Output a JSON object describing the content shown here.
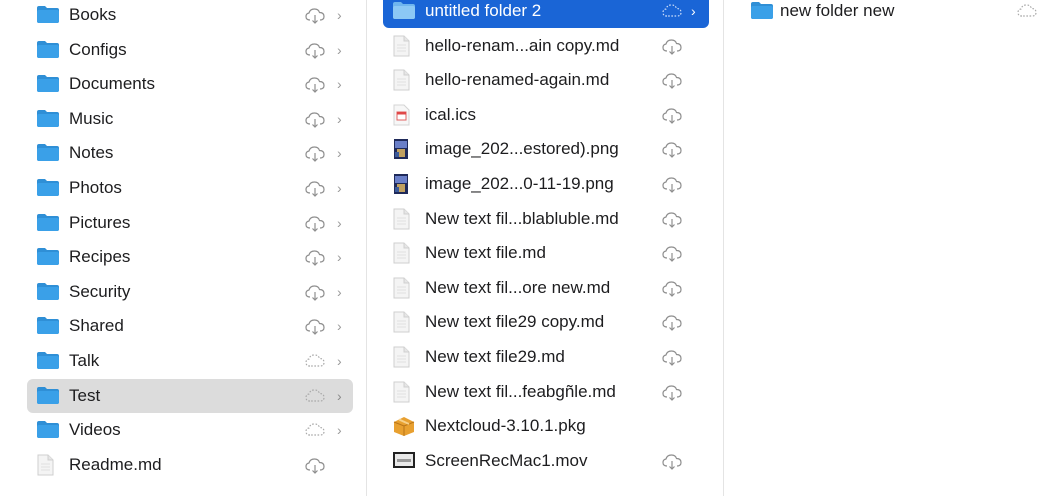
{
  "columns": {
    "first": {
      "items": [
        {
          "label": "Books",
          "type": "folder",
          "cloud": "download",
          "chevron": "›",
          "selected": "none"
        },
        {
          "label": "Configs",
          "type": "folder",
          "cloud": "download",
          "chevron": "›",
          "selected": "none"
        },
        {
          "label": "Documents",
          "type": "folder",
          "cloud": "download",
          "chevron": "›",
          "selected": "none"
        },
        {
          "label": "Music",
          "type": "folder",
          "cloud": "download",
          "chevron": "›",
          "selected": "none"
        },
        {
          "label": "Notes",
          "type": "folder",
          "cloud": "download",
          "chevron": "›",
          "selected": "none"
        },
        {
          "label": "Photos",
          "type": "folder",
          "cloud": "download",
          "chevron": "›",
          "selected": "none"
        },
        {
          "label": "Pictures",
          "type": "folder",
          "cloud": "download",
          "chevron": "›",
          "selected": "none"
        },
        {
          "label": "Recipes",
          "type": "folder",
          "cloud": "download",
          "chevron": "›",
          "selected": "none"
        },
        {
          "label": "Security",
          "type": "folder",
          "cloud": "download",
          "chevron": "›",
          "selected": "none"
        },
        {
          "label": "Shared",
          "type": "folder",
          "cloud": "download",
          "chevron": "›",
          "selected": "none"
        },
        {
          "label": "Talk",
          "type": "folder",
          "cloud": "dotted",
          "chevron": "›",
          "selected": "none"
        },
        {
          "label": "Test",
          "type": "folder",
          "cloud": "dotted",
          "chevron": "›",
          "selected": "gray"
        },
        {
          "label": "Videos",
          "type": "folder",
          "cloud": "dotted",
          "chevron": "›",
          "selected": "none"
        },
        {
          "label": "Readme.md",
          "type": "doc",
          "cloud": "download",
          "chevron": "",
          "selected": "none"
        }
      ]
    },
    "second": {
      "items": [
        {
          "label": "untitled folder 2",
          "type": "folder",
          "cloud": "dotted",
          "chevron": "›",
          "selected": "blue"
        },
        {
          "label": "hello-renam...ain copy.md",
          "type": "doc",
          "cloud": "download",
          "chevron": "",
          "selected": "none"
        },
        {
          "label": "hello-renamed-again.md",
          "type": "doc",
          "cloud": "download",
          "chevron": "",
          "selected": "none"
        },
        {
          "label": "ical.ics",
          "type": "ics",
          "cloud": "download",
          "chevron": "",
          "selected": "none"
        },
        {
          "label": "image_202...estored).png",
          "type": "image",
          "cloud": "download",
          "chevron": "",
          "selected": "none"
        },
        {
          "label": "image_202...0-11-19.png",
          "type": "image",
          "cloud": "download",
          "chevron": "",
          "selected": "none"
        },
        {
          "label": "New text fil...blabluble.md",
          "type": "doc",
          "cloud": "download",
          "chevron": "",
          "selected": "none"
        },
        {
          "label": "New text file.md",
          "type": "doc",
          "cloud": "download",
          "chevron": "",
          "selected": "none"
        },
        {
          "label": "New text fil...ore new.md",
          "type": "doc",
          "cloud": "download",
          "chevron": "",
          "selected": "none"
        },
        {
          "label": "New text file29 copy.md",
          "type": "doc",
          "cloud": "download",
          "chevron": "",
          "selected": "none"
        },
        {
          "label": "New text file29.md",
          "type": "doc",
          "cloud": "download",
          "chevron": "",
          "selected": "none"
        },
        {
          "label": "New text fil...feabgñle.md",
          "type": "doc",
          "cloud": "download",
          "chevron": "",
          "selected": "none"
        },
        {
          "label": "Nextcloud-3.10.1.pkg",
          "type": "pkg",
          "cloud": "none",
          "chevron": "",
          "selected": "none"
        },
        {
          "label": "ScreenRecMac1.mov",
          "type": "movie",
          "cloud": "download",
          "chevron": "",
          "selected": "none"
        }
      ]
    },
    "third": {
      "items": [
        {
          "label": "new folder new",
          "type": "folder",
          "cloud": "dotted",
          "chevron": "",
          "selected": "none"
        }
      ]
    }
  },
  "colors": {
    "folder": "#3aa0e8",
    "folder_tab": "#2f8fd6",
    "selection_blue": "#1a65d6",
    "selection_gray": "#dcdcdc",
    "icon_gray": "#8e8e8e"
  }
}
